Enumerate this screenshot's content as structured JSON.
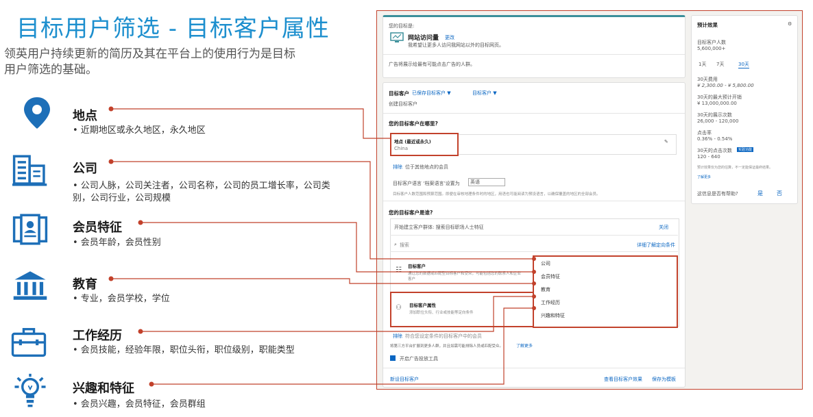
{
  "page": {
    "title": "目标用户筛选 - 目标客户属性",
    "subtitle": "领英用户持续更新的简历及其在平台上的使用行为是目标用户筛选的基础。"
  },
  "categories": [
    {
      "title": "地点",
      "desc": "• 近期地区或永久地区，永久地区",
      "icon": "location-pin-icon"
    },
    {
      "title": "公司",
      "desc": "• 公司人脉，公司关注者，公司名称，公司的员工增长率，公司类别，公司行业，公司规模",
      "icon": "building-icon"
    },
    {
      "title": "会员特征",
      "desc": "• 会员年龄，会员性别",
      "icon": "id-card-icon"
    },
    {
      "title": "教育",
      "desc": "• 专业，会员学校，学位",
      "icon": "institution-icon"
    },
    {
      "title": "工作经历",
      "desc": "• 会员技能，经验年限，职位头衔，职位级别，职能类型",
      "icon": "briefcase-icon"
    },
    {
      "title": "兴趣和特征",
      "desc": "• 会员兴趣，会员特征，会员群组",
      "icon": "lightbulb-icon"
    }
  ],
  "colors": {
    "title": "#1d8fce",
    "accent": "#c2412b",
    "icon": "#1d6fb8"
  },
  "screenshot": {
    "objective_label": "您的目标是:",
    "objective_name": "网站访问量",
    "objective_change": "更改",
    "objective_desc": "我希望让更多人访问我网站以外的目标网页。",
    "objective_note": "广告将展示给最有可能点击广告的人群。",
    "audience_label": "目标客户",
    "saved_audience": "已保存目标客户 ▼",
    "audience_dropdown": "目标客户 ▼",
    "create_audience": "创建目标客户",
    "where_q": "您的目标客户在哪里?",
    "location_label": "地点 (最近或永久)",
    "location_value": "China",
    "exclude": "排除",
    "exclude_loc_desc": "位于其他地点的会员",
    "lang_label": "目标客户语言 ‘档案语言’设置为",
    "lang_value": "英语",
    "lang_note": "目标客户人数范围和预算范围。即便在审核地理条件时的地区，用语也可能阅读为预设语言，以确保覆盖的地区的全部会员。",
    "who_q": "您的目标客户是谁?",
    "build_label": "开始建立客户群体: 搜索目标职场人士特征",
    "close": "关闭",
    "search_placeholder": "搜索",
    "more_conditions": "详细了解定向条件",
    "audiences_title": "目标客户",
    "audiences_desc": "通过您的数据或匹配型目标客户和受众，可能包括您的联系人和企业客户",
    "attributes_title": "目标客户属性",
    "attributes_desc": "添加职位头衔、行业或技能等定向条件",
    "menu": [
      "公司",
      "会员特征",
      "教育",
      "工作经历",
      "兴趣和特征"
    ],
    "exclude2": "排除",
    "exclude2_desc": "符合您设定条件的目标客户中的会员",
    "expand_note": "将第三方平台扩展到更多人群，并且如需可能排除人员或匹配受众。",
    "learn_more": "了解更多",
    "audience_network": "开启广告投放工具",
    "save_audience": "新设目标客户",
    "view_audience": "查看目标客户效果",
    "save_template": "保存为模板",
    "forecast_title": "预计效果",
    "target_size_label": "目标客户人数",
    "target_size": "5,600,000+",
    "tabs": [
      "1天",
      "7天",
      "30天"
    ],
    "spend_label": "30天费用",
    "spend": "¥ 2,300.00 - ¥ 5,800.00",
    "budget_label": "30天的最大预计开销",
    "budget": "¥ 13,000,000.00",
    "impressions_label": "30天的展示次数",
    "impressions": "26,000 - 120,000",
    "ctr_label": "点击率",
    "ctr": "0.36% - 0.54%",
    "clicks_label": "30天的点击次数",
    "clicks_badge": "实验功能",
    "clicks": "120 - 640",
    "disclaimer": "预计效果仅为您的估算，不一定能保证最终结果。",
    "disclaimer_link": "了解更多",
    "helpful_q": "这信息是否有帮助?",
    "yes": "是",
    "no": "否"
  }
}
